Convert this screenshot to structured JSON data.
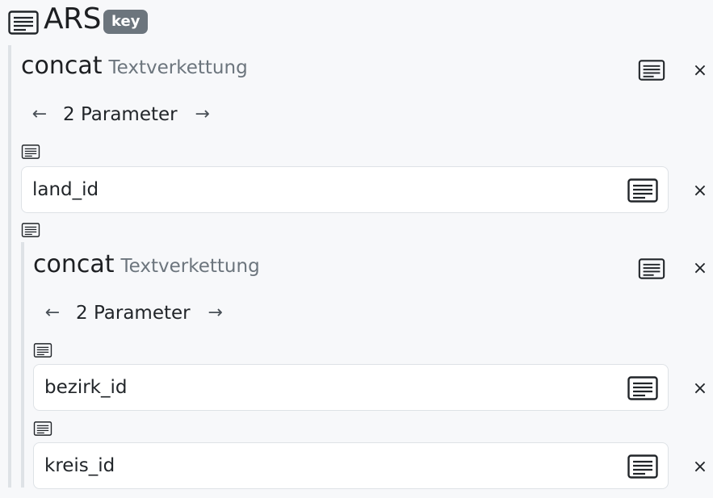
{
  "header": {
    "title": "ARS",
    "badge": "key",
    "doc_icon": "doc-lines-icon"
  },
  "outer_function": {
    "name": "concat",
    "description": "Textverkettung",
    "pager": {
      "prev": "←",
      "label": "2 Parameter",
      "next": "→"
    },
    "close_label": "×",
    "params": [
      {
        "value": "land_id",
        "close_label": "×"
      }
    ]
  },
  "inner_function": {
    "name": "concat",
    "description": "Textverkettung",
    "pager": {
      "prev": "←",
      "label": "2 Parameter",
      "next": "→"
    },
    "close_label": "×",
    "params": [
      {
        "value": "bezirk_id",
        "close_label": "×"
      },
      {
        "value": "kreis_id",
        "close_label": "×"
      }
    ]
  },
  "colors": {
    "background": "#f7f8fa",
    "badge": "#6c757d",
    "field_border": "#dee2e6",
    "guide_line": "#dee2e6"
  }
}
